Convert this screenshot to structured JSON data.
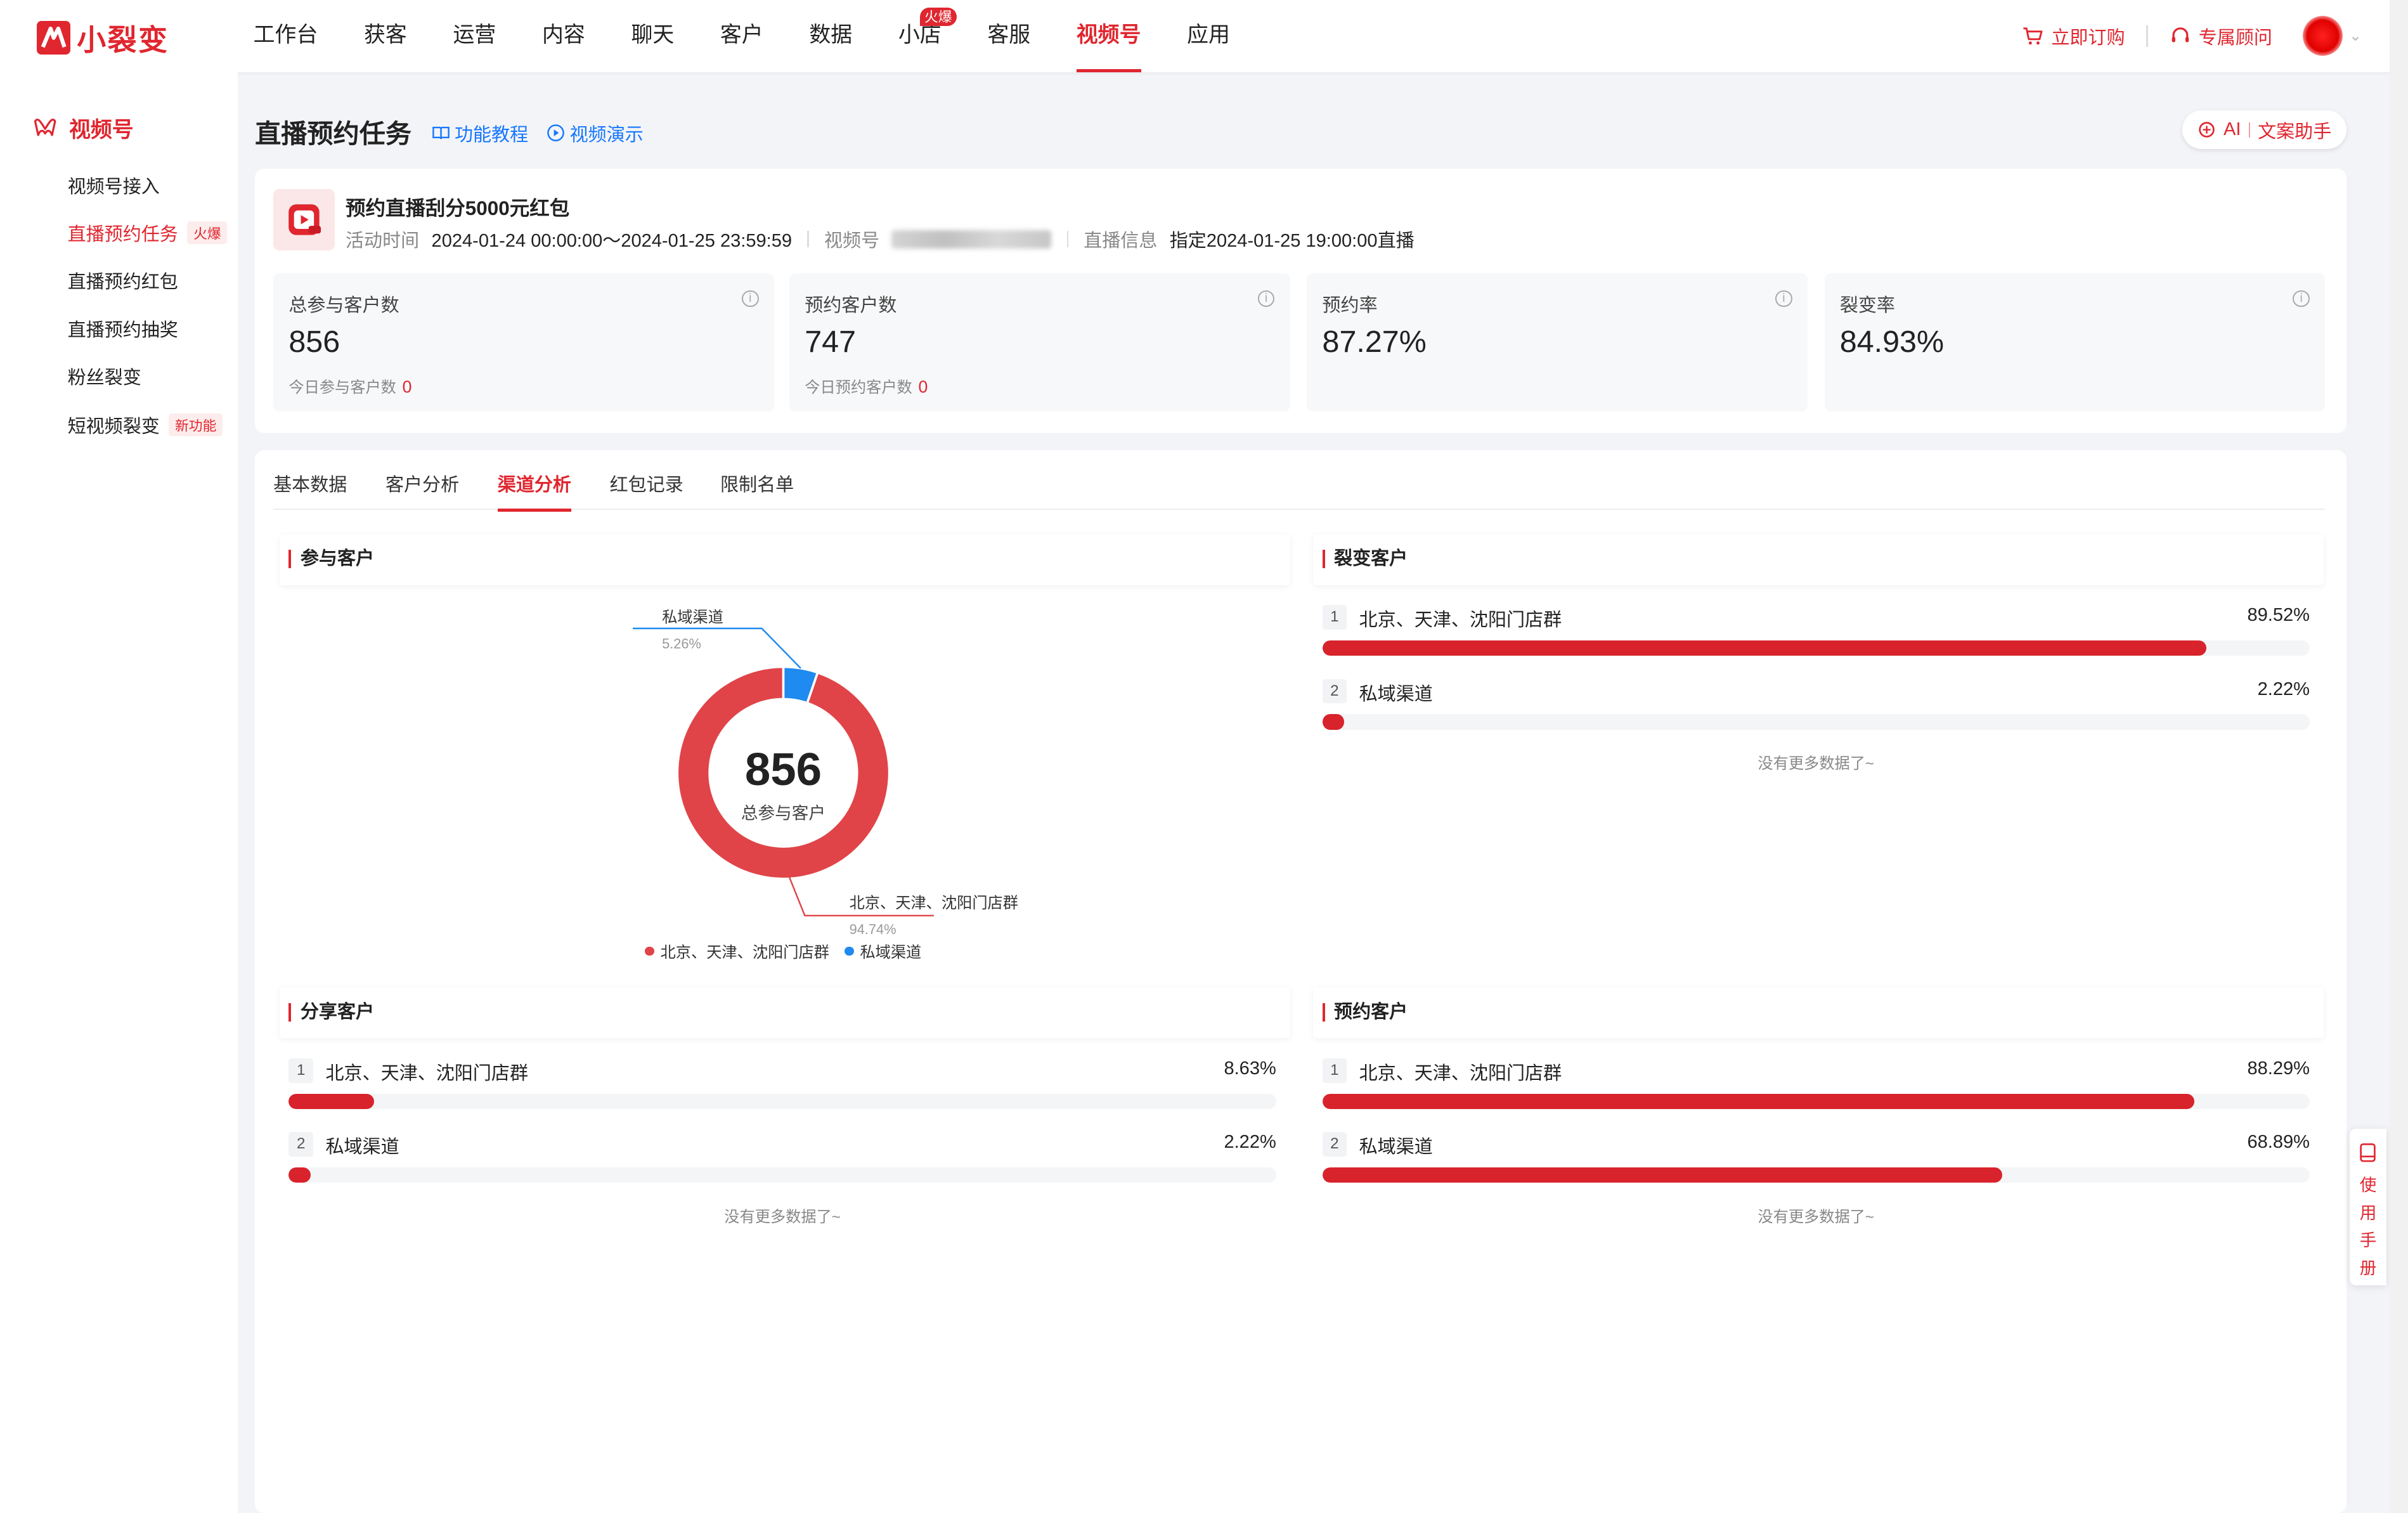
{
  "brand": {
    "name": "小裂变",
    "accent": "#e0262f",
    "secondary": "#1677ff"
  },
  "nav": {
    "items": [
      {
        "label": "工作台"
      },
      {
        "label": "获客"
      },
      {
        "label": "运营"
      },
      {
        "label": "内容"
      },
      {
        "label": "聊天"
      },
      {
        "label": "客户"
      },
      {
        "label": "数据"
      },
      {
        "label": "小店",
        "badge": "火爆"
      },
      {
        "label": "客服"
      },
      {
        "label": "视频号",
        "active": true
      },
      {
        "label": "应用"
      }
    ],
    "subscribe": "立即订购",
    "advisor": "专属顾问"
  },
  "sidebar": {
    "heading": "视频号",
    "items": [
      {
        "label": "视频号接入"
      },
      {
        "label": "直播预约任务",
        "tag": "火爆",
        "active": true
      },
      {
        "label": "直播预约红包"
      },
      {
        "label": "直播预约抽奖"
      },
      {
        "label": "粉丝裂变"
      },
      {
        "label": "短视频裂变",
        "tag": "新功能"
      }
    ]
  },
  "header": {
    "title": "直播预约任务",
    "tutorial": "功能教程",
    "video_demo": "视频演示",
    "ai_label": "AI",
    "ai_assistant": "文案助手"
  },
  "activity": {
    "title": "预约直播刮分5000元红包",
    "time_label": "活动时间",
    "time_value": "2024-01-24 00:00:00～2024-01-25 23:59:59",
    "channel_label": "视频号",
    "live_label": "直播信息",
    "live_value": "指定2024-01-25 19:00:00直播"
  },
  "stats": [
    {
      "label": "总参与客户数",
      "value": "856",
      "sub_label": "今日参与客户数",
      "sub_value": "0"
    },
    {
      "label": "预约客户数",
      "value": "747",
      "sub_label": "今日预约客户数",
      "sub_value": "0"
    },
    {
      "label": "预约率",
      "value": "87.27%"
    },
    {
      "label": "裂变率",
      "value": "84.93%"
    }
  ],
  "tabs": [
    {
      "label": "基本数据"
    },
    {
      "label": "客户分析"
    },
    {
      "label": "渠道分析",
      "active": true
    },
    {
      "label": "红包记录"
    },
    {
      "label": "限制名单"
    }
  ],
  "panels": {
    "participants": {
      "title": "参与客户",
      "center_value": "856",
      "center_label": "总参与客户"
    },
    "fission": {
      "title": "裂变客户",
      "rows": [
        {
          "rank": "1",
          "name": "北京、天津、沈阳门店群",
          "pct": "89.52%",
          "value": 0.8952
        },
        {
          "rank": "2",
          "name": "私域渠道",
          "pct": "2.22%",
          "value": 0.0222
        }
      ],
      "footer": "没有更多数据了~"
    },
    "share": {
      "title": "分享客户",
      "rows": [
        {
          "rank": "1",
          "name": "北京、天津、沈阳门店群",
          "pct": "8.63%",
          "value": 0.0863
        },
        {
          "rank": "2",
          "name": "私域渠道",
          "pct": "2.22%",
          "value": 0.0222
        }
      ],
      "footer": "没有更多数据了~"
    },
    "reserve": {
      "title": "预约客户",
      "rows": [
        {
          "rank": "1",
          "name": "北京、天津、沈阳门店群",
          "pct": "88.29%",
          "value": 0.8829
        },
        {
          "rank": "2",
          "name": "私域渠道",
          "pct": "68.89%",
          "value": 0.6889
        }
      ],
      "footer": "没有更多数据了~"
    }
  },
  "chart_data": {
    "type": "pie",
    "categories": [
      "北京、天津、沈阳门店群",
      "私域渠道"
    ],
    "values": [
      94.74,
      5.26
    ],
    "value_labels": [
      "94.74%",
      "5.26%"
    ],
    "colors": [
      "#e04448",
      "#1f8af0"
    ],
    "legend_position": "bottom"
  },
  "manual": {
    "label": "使用手册"
  }
}
